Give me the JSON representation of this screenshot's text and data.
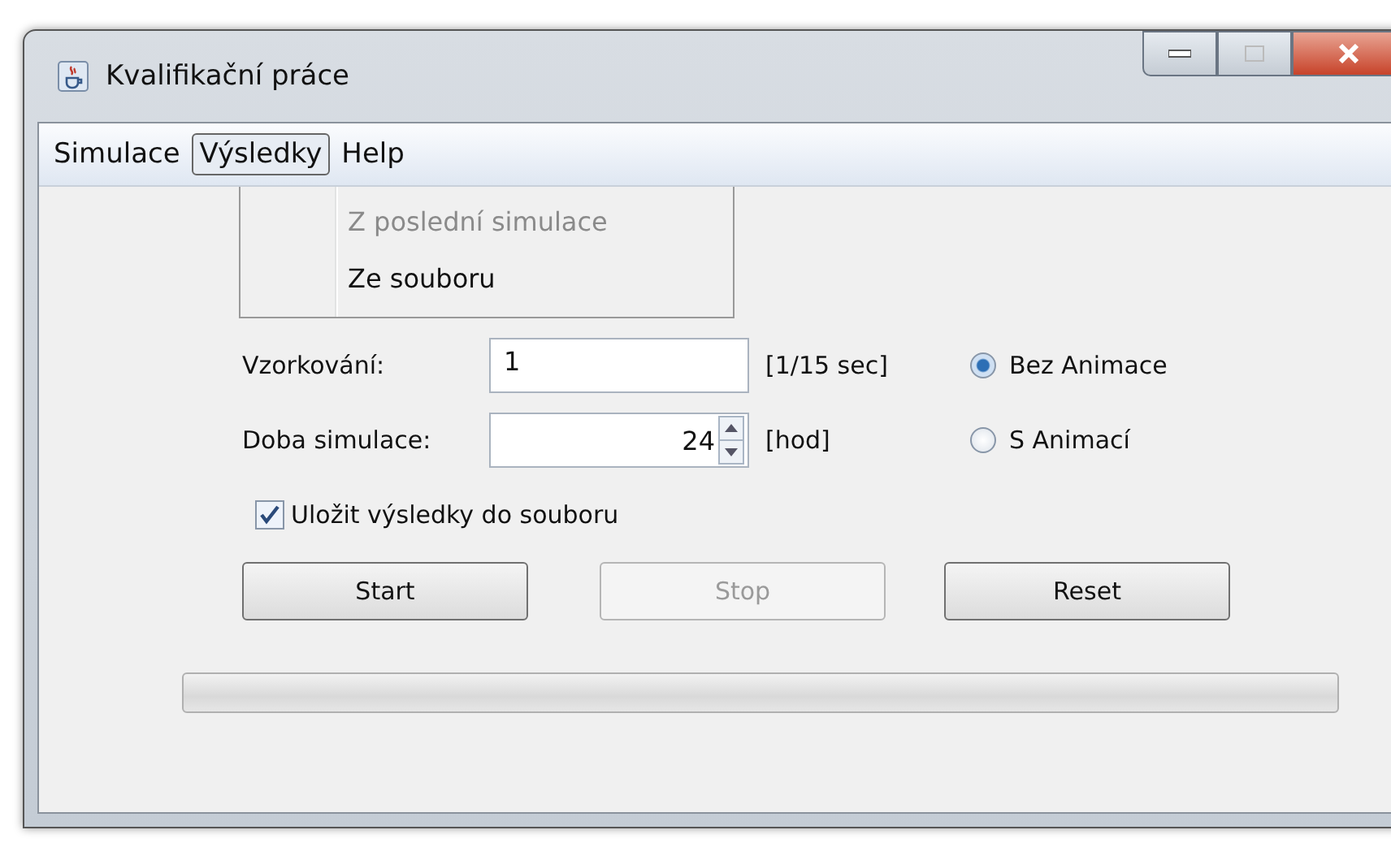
{
  "window": {
    "title": "Kvalifikační práce"
  },
  "menu_bar": [
    {
      "label": "Simulace",
      "selected": false
    },
    {
      "label": "Výsledky",
      "selected": true
    },
    {
      "label": "Help",
      "selected": false
    }
  ],
  "open_menu": [
    {
      "label": "Z poslední simulace",
      "disabled": true
    },
    {
      "label": "Ze souboru",
      "disabled": false
    }
  ],
  "form": {
    "sampling_label": "Vzorkování:",
    "sampling_value": "1",
    "sampling_unit": "[1/15 sec]",
    "duration_label": "Doba simulace:",
    "duration_value": "24",
    "duration_unit": "[hod]"
  },
  "radios": [
    {
      "label": "Bez Animace",
      "selected": true
    },
    {
      "label": "S Animací",
      "selected": false
    }
  ],
  "save_checkbox": {
    "label": "Uložit výsledky do souboru",
    "checked": true
  },
  "buttons": [
    {
      "label": "Start",
      "disabled": false
    },
    {
      "label": "Stop",
      "disabled": true
    },
    {
      "label": "Reset",
      "disabled": false
    }
  ]
}
